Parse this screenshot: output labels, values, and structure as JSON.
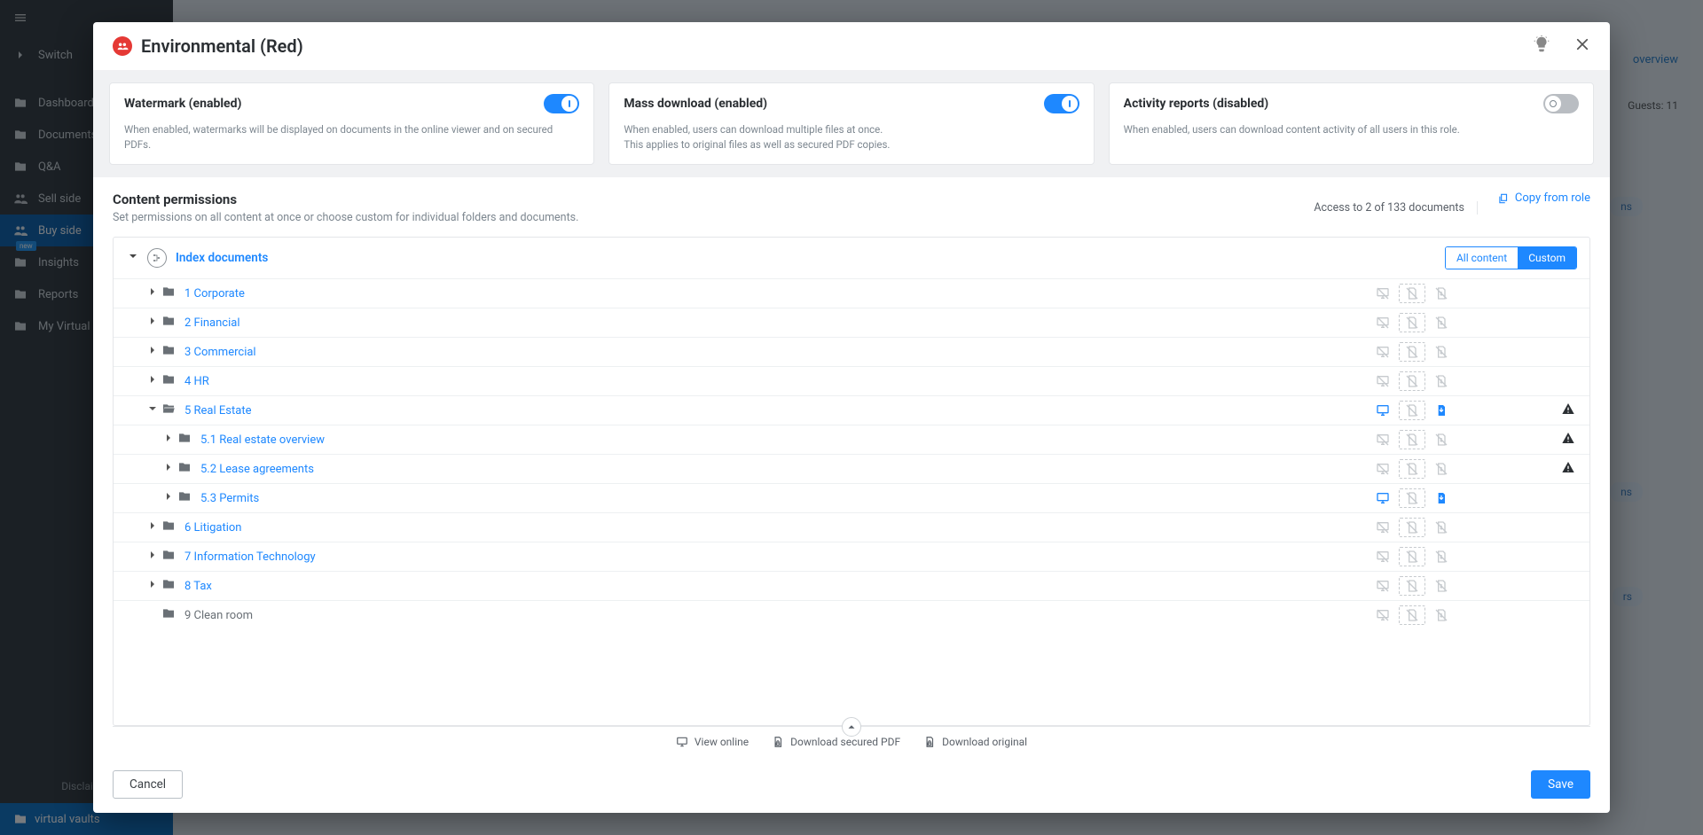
{
  "sidebar": {
    "items": [
      {
        "label": "Switch"
      },
      {
        "label": "Dashboard"
      },
      {
        "label": "Documents"
      },
      {
        "label": "Q&A"
      },
      {
        "label": "Sell side"
      },
      {
        "label": "Buy side"
      },
      {
        "label": "Insights",
        "badge": "new"
      },
      {
        "label": "Reports"
      },
      {
        "label": "My Virtual"
      }
    ],
    "disclaimer": "Disclaimer",
    "brand": "virtual vaults"
  },
  "bg": {
    "guests": "Guests: 11",
    "overview_link": "overview"
  },
  "modal": {
    "title": "Environmental (Red)",
    "cards": {
      "watermark": {
        "title": "Watermark (enabled)",
        "desc": "When enabled, watermarks will be displayed on documents in the online viewer and on secured PDFs.",
        "state": "on"
      },
      "download": {
        "title": "Mass download (enabled)",
        "desc_l1": "When enabled, users can download multiple files at once.",
        "desc_l2": "This applies to original files as well as secured PDF copies.",
        "state": "on"
      },
      "activity": {
        "title": "Activity reports (disabled)",
        "desc": "When enabled, users can download content activity of all users in this role.",
        "state": "off"
      }
    },
    "perm": {
      "title": "Content permissions",
      "subtitle": "Set permissions on all content at once or choose custom for individual folders and documents.",
      "access": "Access to 2 of 133 documents",
      "copy": "Copy from role",
      "index_label": "Index documents",
      "all_label": "All content",
      "custom_label": "Custom"
    },
    "tree": [
      {
        "id": "1",
        "label": "1 Corporate",
        "depth": 1,
        "expandable": true,
        "open": false,
        "perm": "none"
      },
      {
        "id": "2",
        "label": "2 Financial",
        "depth": 1,
        "expandable": true,
        "open": false,
        "perm": "none"
      },
      {
        "id": "3",
        "label": "3 Commercial",
        "depth": 1,
        "expandable": true,
        "open": false,
        "perm": "none"
      },
      {
        "id": "4",
        "label": "4 HR",
        "depth": 1,
        "expandable": true,
        "open": false,
        "perm": "none"
      },
      {
        "id": "5",
        "label": "5 Real Estate",
        "depth": 1,
        "expandable": true,
        "open": true,
        "perm": "mixed",
        "warn": true
      },
      {
        "id": "51",
        "label": "5.1 Real estate overview",
        "depth": 2,
        "expandable": true,
        "open": false,
        "perm": "none",
        "warn": true
      },
      {
        "id": "52",
        "label": "5.2 Lease agreements",
        "depth": 2,
        "expandable": true,
        "open": false,
        "perm": "none",
        "warn": true
      },
      {
        "id": "53",
        "label": "5.3 Permits",
        "depth": 2,
        "expandable": true,
        "open": false,
        "perm": "mixed"
      },
      {
        "id": "6",
        "label": "6 Litigation",
        "depth": 1,
        "expandable": true,
        "open": false,
        "perm": "none"
      },
      {
        "id": "7",
        "label": "7 Information Technology",
        "depth": 1,
        "expandable": true,
        "open": false,
        "perm": "none"
      },
      {
        "id": "8",
        "label": "8 Tax",
        "depth": 1,
        "expandable": true,
        "open": false,
        "perm": "none"
      },
      {
        "id": "9",
        "label": "9 Clean room",
        "depth": 1,
        "expandable": false,
        "open": false,
        "perm": "none",
        "muted": true
      }
    ],
    "legend": {
      "view": "View online",
      "secured": "Download secured PDF",
      "original": "Download original"
    },
    "buttons": {
      "cancel": "Cancel",
      "save": "Save"
    }
  }
}
